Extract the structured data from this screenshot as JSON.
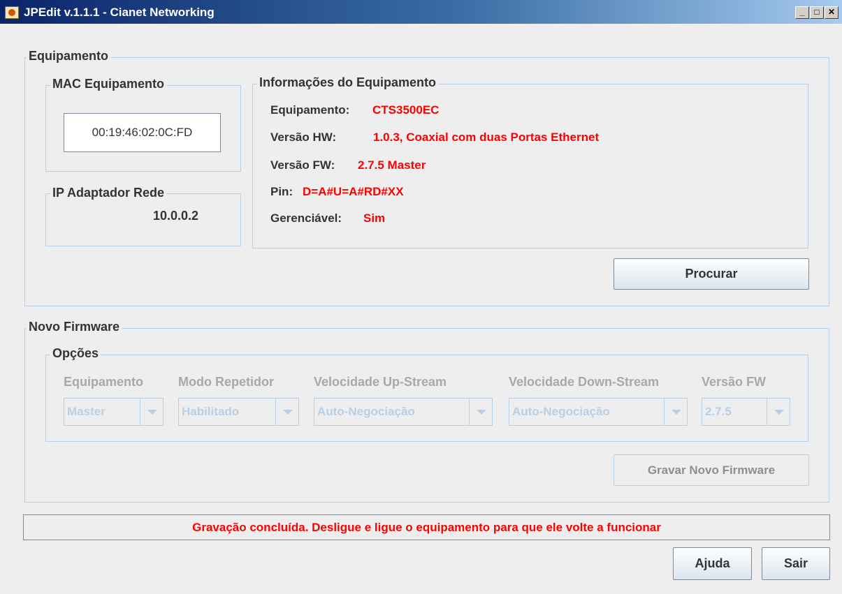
{
  "window": {
    "title": "JPEdit v.1.1.1 - Cianet Networking"
  },
  "equipamento": {
    "legend": "Equipamento",
    "mac": {
      "legend": "MAC Equipamento",
      "value": "00:19:46:02:0C:FD"
    },
    "ip": {
      "legend": "IP Adaptador Rede",
      "value": "10.0.0.2"
    },
    "info": {
      "legend": "Informações do Equipamento",
      "equipamento_label": "Equipamento:",
      "equipamento_value": "CTS3500EC",
      "hw_label": "Versão HW:",
      "hw_value": "1.0.3, Coaxial com duas Portas Ethernet",
      "fw_label": "Versão FW:",
      "fw_value": "2.7.5 Master",
      "pin_label": "Pin:",
      "pin_value": "D=A#U=A#RD#XX",
      "gerenciavel_label": "Gerenciável:",
      "gerenciavel_value": "Sim"
    },
    "procurar_label": "Procurar"
  },
  "novo_firmware": {
    "legend": "Novo Firmware",
    "opcoes_legend": "Opções",
    "headers": {
      "equipamento": "Equipamento",
      "modo_repetidor": "Modo Repetidor",
      "upstream": "Velocidade Up-Stream",
      "downstream": "Velocidade Down-Stream",
      "versao_fw": "Versão FW"
    },
    "values": {
      "equipamento": "Master",
      "modo_repetidor": "Habilitado",
      "upstream": "Auto-Negociação",
      "downstream": "Auto-Negociação",
      "versao_fw": "2.7.5"
    },
    "gravar_label": "Gravar Novo Firmware"
  },
  "status": {
    "message": "Gravação concluída. Desligue e ligue o equipamento para que ele volte a funcionar"
  },
  "footer": {
    "ajuda_label": "Ajuda",
    "sair_label": "Sair"
  }
}
